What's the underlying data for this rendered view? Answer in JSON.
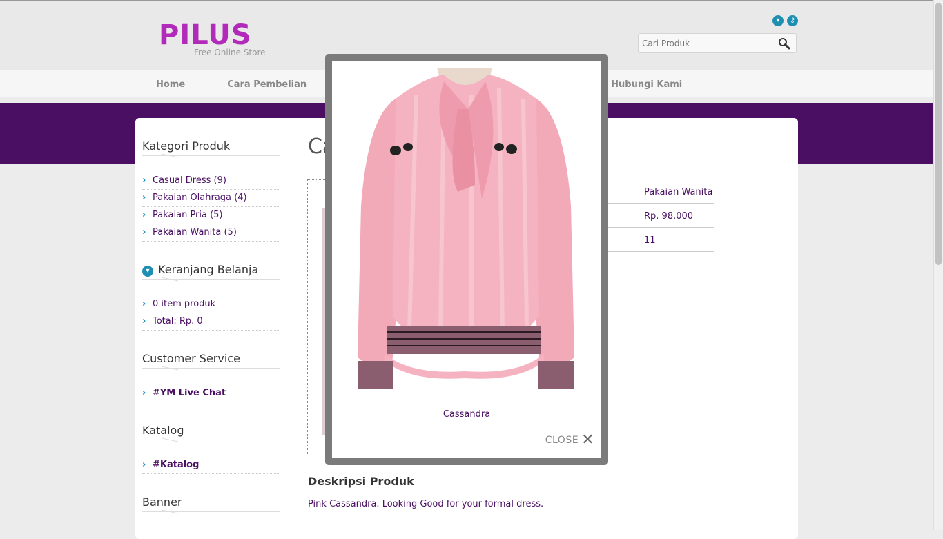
{
  "header": {
    "logo_text": "PILUS",
    "tagline": "Free Online Store",
    "search_placeholder": "Cari Produk",
    "icons": [
      "cart-icon",
      "key-icon"
    ]
  },
  "nav": {
    "items": [
      "Home",
      "Cara Pembelian",
      "Hubungi Kami"
    ]
  },
  "sidebar": {
    "categories_title": "Kategori Produk",
    "categories": [
      "Casual Dress (9)",
      "Pakaian Olahraga (4)",
      "Pakaian Pria (5)",
      "Pakaian Wanita (5)"
    ],
    "cart_title": "Keranjang Belanja",
    "cart_items": [
      "0 item produk",
      "Total: Rp. 0"
    ],
    "cs_title": "Customer Service",
    "cs_items": [
      "#YM Live Chat"
    ],
    "catalog_title": "Katalog",
    "catalog_items": [
      "#Katalog"
    ],
    "banner_title": "Banner"
  },
  "main": {
    "title": "Ca",
    "info": [
      "Pakaian Wanita",
      "Rp. 98.000",
      "11"
    ],
    "desc_title": "Deskripsi Produk",
    "desc_text": "Pink Cassandra. Looking Good for your formal dress."
  },
  "lightbox": {
    "caption": "Cassandra",
    "close_label": "CLOSE"
  },
  "colors": {
    "brand_purple": "#4a0f62",
    "logo_magenta": "#b22ab9",
    "accent_blue": "#1e8fb3"
  }
}
